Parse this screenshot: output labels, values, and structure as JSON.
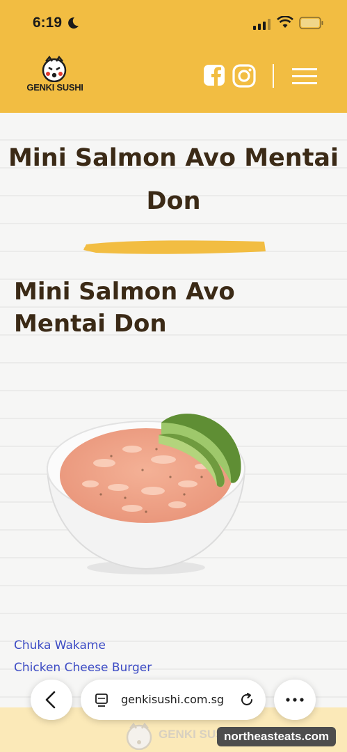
{
  "status_bar": {
    "time": "6:19",
    "icons": [
      "moon-icon",
      "cellular-signal-icon",
      "wifi-icon",
      "battery-icon"
    ]
  },
  "header": {
    "logo_text": "GENKI SUSHI",
    "social_icons": [
      "facebook-icon",
      "instagram-icon"
    ],
    "menu_icon": "hamburger-menu-icon",
    "background": "#f2bd42"
  },
  "page": {
    "title": "Mini Salmon Avo Mentai Don",
    "product_name": "Mini Salmon Avo Mentai Don",
    "text_color": "#3b2a16",
    "accent": "#f2bd42"
  },
  "related_links": [
    {
      "label": "Chuka Wakame"
    },
    {
      "label": "Chicken Cheese Burger"
    }
  ],
  "browser_toolbar": {
    "url": "genkisushi.com.sg",
    "icons": [
      "back-arrow-icon",
      "tabs-icon",
      "reload-icon",
      "more-dots-icon"
    ]
  },
  "footer": {
    "logo_text": "GENKI SUSHI",
    "watermark": "northeasteats.com"
  }
}
